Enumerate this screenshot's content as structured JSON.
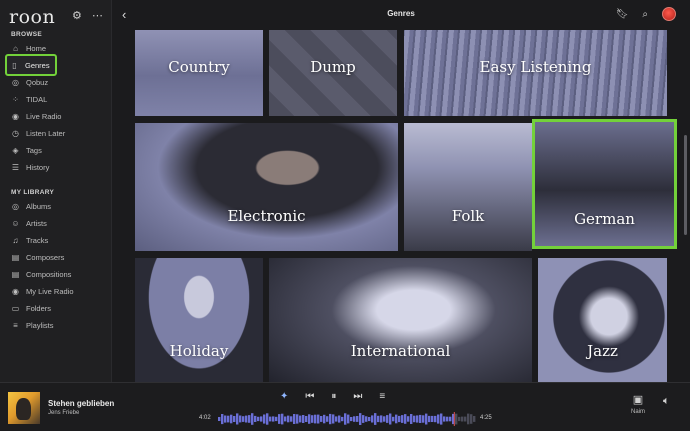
{
  "app": {
    "logo": "roon",
    "title": "Genres"
  },
  "sidebar": {
    "browse_title": "BROWSE",
    "browse": [
      {
        "label": "Home",
        "icon": "home-icon",
        "glyph": "⌂"
      },
      {
        "label": "Genres",
        "icon": "genres-icon",
        "glyph": "▯",
        "active": true
      },
      {
        "label": "Qobuz",
        "icon": "qobuz-icon",
        "glyph": "◎"
      },
      {
        "label": "TIDAL",
        "icon": "tidal-icon",
        "glyph": "⁘"
      },
      {
        "label": "Live Radio",
        "icon": "radio-icon",
        "glyph": "◉"
      },
      {
        "label": "Listen Later",
        "icon": "clock-icon",
        "glyph": "◷"
      },
      {
        "label": "Tags",
        "icon": "tag-icon",
        "glyph": "◈"
      },
      {
        "label": "History",
        "icon": "history-icon",
        "glyph": "☰"
      }
    ],
    "library_title": "MY LIBRARY",
    "library": [
      {
        "label": "Albums",
        "icon": "album-icon",
        "glyph": "◎"
      },
      {
        "label": "Artists",
        "icon": "artist-icon",
        "glyph": "☺"
      },
      {
        "label": "Tracks",
        "icon": "tracks-icon",
        "glyph": "♫"
      },
      {
        "label": "Composers",
        "icon": "composer-icon",
        "glyph": "▤"
      },
      {
        "label": "Compositions",
        "icon": "composition-icon",
        "glyph": "▤"
      },
      {
        "label": "My Live Radio",
        "icon": "radio-icon",
        "glyph": "◉"
      },
      {
        "label": "Folders",
        "icon": "folder-icon",
        "glyph": "▭"
      },
      {
        "label": "Playlists",
        "icon": "playlist-icon",
        "glyph": "≡"
      }
    ]
  },
  "genres": [
    {
      "label": "Country"
    },
    {
      "label": "Dump"
    },
    {
      "label": "Easy Listening"
    },
    {
      "label": "Electronic"
    },
    {
      "label": "Folk"
    },
    {
      "label": "German",
      "selected": true
    },
    {
      "label": "Holiday"
    },
    {
      "label": "International"
    },
    {
      "label": "Jazz"
    }
  ],
  "player": {
    "title": "Stehen geblieben",
    "artist": "Jens Friebe",
    "elapsed": "4:02",
    "duration": "4:25",
    "progress": 0.914,
    "zone": "Naim"
  },
  "colors": {
    "highlight": "#73d13a",
    "tile_tint": "#7c7fa6",
    "progress": "#e05050",
    "wave": "#6a6fd6"
  }
}
